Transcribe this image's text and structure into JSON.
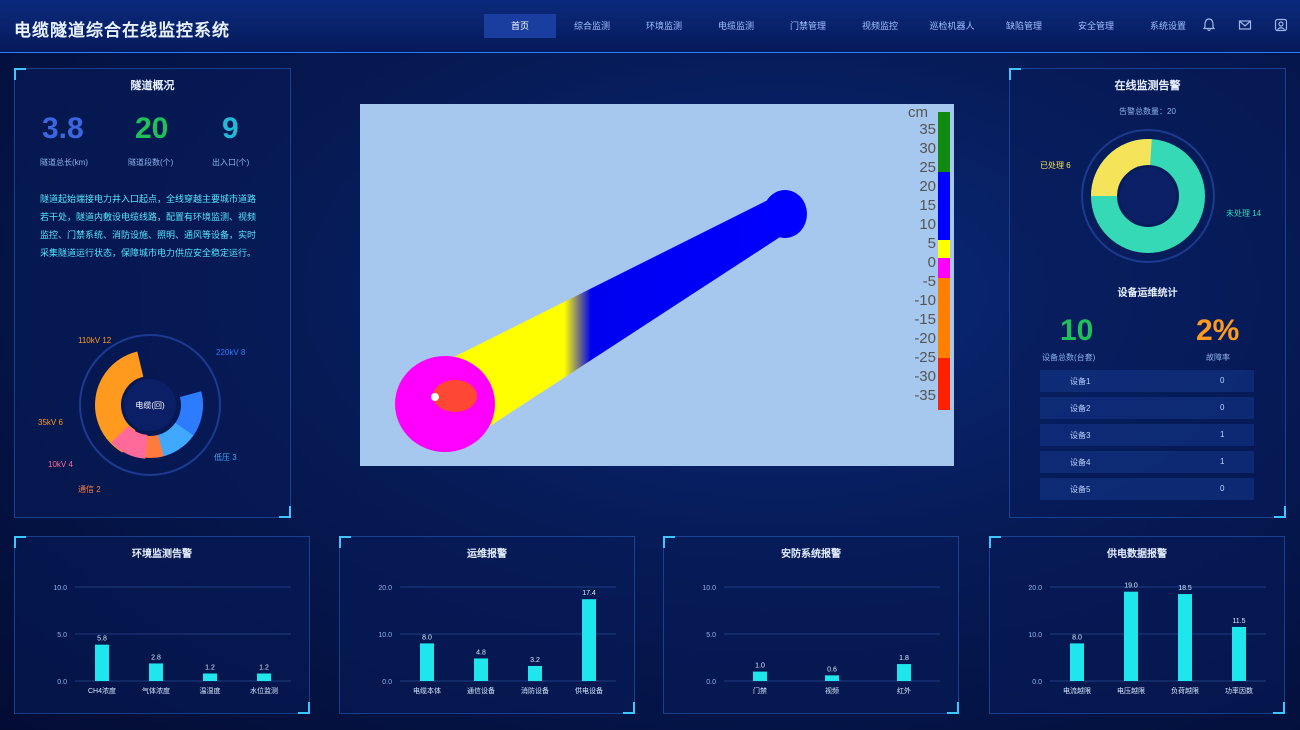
{
  "header": {
    "title": "电缆隧道综合在线监控系统",
    "nav": [
      "首页",
      "综合监测",
      "环境监测",
      "电缆监测",
      "门禁管理",
      "视频监控",
      "巡检机器人",
      "缺陷管理",
      "安全管理",
      "系统设置"
    ],
    "icons": [
      "bell-icon",
      "mail-icon",
      "user-icon"
    ]
  },
  "left_panel": {
    "title": "隧道概况",
    "stats": [
      {
        "value": "3.8",
        "label": "隧道总长(km)",
        "color": "#3b66e0"
      },
      {
        "value": "20",
        "label": "隧道段数(个)",
        "color": "#1fbf5a"
      },
      {
        "value": "9",
        "label": "出入口(个)",
        "color": "#23b8d6"
      }
    ],
    "description": "隧道起始端接电力井入口起点，全线穿越主要城市道路若干处，隧道内敷设电缆线路，配置有环境监测、视频监控、门禁系统、消防设施、照明、通风等设备，实时采集隧道运行状态，保障城市电力供应安全稳定运行。",
    "donut_center": "电缆(回)",
    "donut_labels": [
      {
        "text": "110kV 12",
        "color": "#ff9a1f"
      },
      {
        "text": "220kV 8",
        "color": "#2d7bff"
      },
      {
        "text": "35kV 6",
        "color": "#ff9a1f"
      },
      {
        "text": "10kV 4",
        "color": "#ff6a9a"
      },
      {
        "text": "通信 2",
        "color": "#ff7a3d"
      },
      {
        "text": "低压 3",
        "color": "#41a8ff"
      }
    ]
  },
  "center": {
    "scale_unit": "cm",
    "scale_labels": [
      "35",
      "30",
      "25",
      "20",
      "15",
      "10",
      "5",
      "0",
      "-5",
      "-10",
      "-15",
      "-20",
      "-25",
      "-30",
      "-35"
    ]
  },
  "right_panel": {
    "title": "在线监测告警",
    "subtitle": "告警总数量：20",
    "donut_labels": [
      {
        "text": "已处理 6",
        "color": "#f5e35a"
      },
      {
        "text": "未处理 14",
        "color": "#36d9b6"
      }
    ],
    "section2_title": "设备运维统计",
    "stat_left": {
      "value": "10",
      "label": "设备总数(台套)"
    },
    "stat_right": {
      "value": "2%",
      "label": "故障率"
    },
    "rows": [
      {
        "name": "设备1",
        "value": "0"
      },
      {
        "name": "设备2",
        "value": "0"
      },
      {
        "name": "设备3",
        "value": "1"
      },
      {
        "name": "设备4",
        "value": "1"
      },
      {
        "name": "设备5",
        "value": "0"
      }
    ]
  },
  "bottom_panels": [
    {
      "title": "环境监测告警"
    },
    {
      "title": "运维报警"
    },
    {
      "title": "安防系统报警"
    },
    {
      "title": "供电数据报警"
    }
  ],
  "chart_data": [
    {
      "type": "bar",
      "title": "环境监测告警",
      "categories": [
        "CH4浓度",
        "气体浓度",
        "温湿度",
        "水位监测"
      ],
      "values": [
        5.8,
        2.8,
        1.2,
        1.2
      ],
      "ylim": [
        0,
        15
      ],
      "yticks": [
        "0.0",
        "5.0",
        "10.0"
      ]
    },
    {
      "type": "bar",
      "title": "运维报警",
      "categories": [
        "电缆本体",
        "通信设备",
        "消防设备",
        "供电设备"
      ],
      "values": [
        8.0,
        4.8,
        3.2,
        17.4
      ],
      "ylim": [
        0,
        20
      ],
      "yticks": [
        "0.0",
        "10.0",
        "20.0"
      ]
    },
    {
      "type": "bar",
      "title": "安防系统报警",
      "categories": [
        "门禁",
        "视频",
        "红外"
      ],
      "values": [
        1.0,
        0.6,
        1.8
      ],
      "ylim": [
        0,
        10
      ],
      "yticks": [
        "0.0",
        "5.0",
        "10.0"
      ]
    },
    {
      "type": "bar",
      "title": "供电数据报警",
      "categories": [
        "电流越限",
        "电压越限",
        "负荷越限",
        "功率因数"
      ],
      "values": [
        8.0,
        19.0,
        18.5,
        11.5
      ],
      "ylim": [
        0,
        20
      ],
      "yticks": [
        "0.0",
        "10.0",
        "20.0"
      ]
    }
  ]
}
